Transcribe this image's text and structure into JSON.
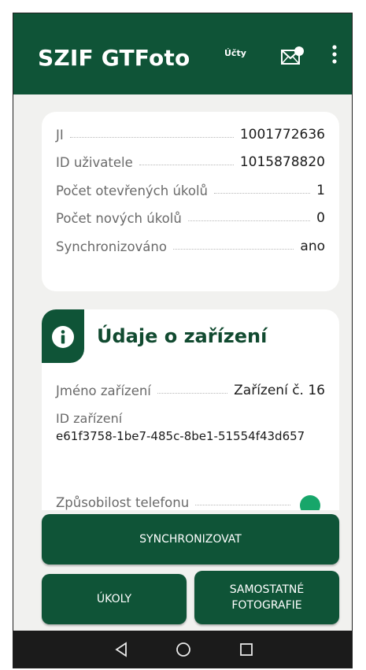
{
  "app": {
    "title": "SZIF GTFoto",
    "accounts_label": "Účty"
  },
  "summary": {
    "rows": [
      {
        "label": "JI",
        "value": "1001772636"
      },
      {
        "label": "ID uživatele",
        "value": "1015878820"
      },
      {
        "label": "Počet otevřených úkolů",
        "value": "1"
      },
      {
        "label": "Počet nových úkolů",
        "value": "0"
      },
      {
        "label": "Synchronizováno",
        "value": "ano"
      }
    ]
  },
  "device": {
    "heading": "Údaje o zařízení",
    "name_label": "Jméno zařízení",
    "name_value": "Zařízení č. 16",
    "id_label": "ID zařízení",
    "id_value": "e61f3758-1be7-485c-8be1-51554f43d657",
    "capability_label": "Způsobilost telefonu"
  },
  "actions": {
    "sync": "SYNCHRONIZOVAT",
    "tasks": "ÚKOLY",
    "photos_line1": "SAMOSTATNÉ",
    "photos_line2": "FOTOGRAFIE"
  },
  "colors": {
    "primary": "#0f5437",
    "status_ok": "#17a66a",
    "background": "#f1f1ef"
  },
  "icons": {
    "mail": "mail-notification-icon",
    "more": "more-vertical-icon",
    "info": "info-icon",
    "back": "nav-back-icon",
    "home": "nav-home-icon",
    "recents": "nav-recents-icon"
  }
}
